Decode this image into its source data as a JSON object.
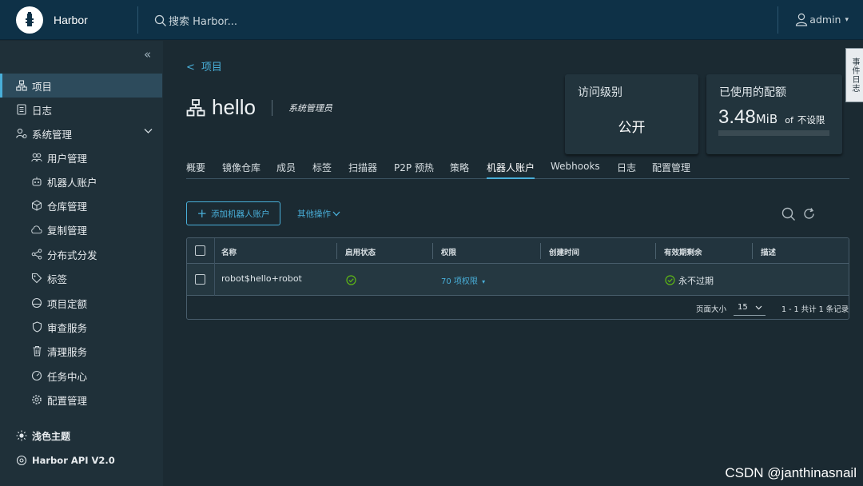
{
  "app": {
    "title": "Harbor"
  },
  "search": {
    "placeholder": "搜索 Harbor..."
  },
  "user": {
    "name": "admin"
  },
  "sidebar": {
    "items": [
      {
        "label": "项目",
        "icon": "projects-icon"
      },
      {
        "label": "日志",
        "icon": "logs-icon"
      },
      {
        "label": "系统管理",
        "icon": "admin-icon"
      },
      {
        "label": "用户管理",
        "icon": "users-icon"
      },
      {
        "label": "机器人账户",
        "icon": "robot-icon"
      },
      {
        "label": "仓库管理",
        "icon": "registry-icon"
      },
      {
        "label": "复制管理",
        "icon": "replication-icon"
      },
      {
        "label": "分布式分发",
        "icon": "distribution-icon"
      },
      {
        "label": "标签",
        "icon": "tag-icon"
      },
      {
        "label": "项目定额",
        "icon": "quota-icon"
      },
      {
        "label": "审查服务",
        "icon": "shield-icon"
      },
      {
        "label": "清理服务",
        "icon": "trash-icon"
      },
      {
        "label": "任务中心",
        "icon": "gauge-icon"
      },
      {
        "label": "配置管理",
        "icon": "gear-icon"
      }
    ],
    "theme_label": "浅色主题",
    "api_label": "Harbor API V2.0"
  },
  "breadcrumb": {
    "label": "项目"
  },
  "project": {
    "name": "hello",
    "role": "系统管理员"
  },
  "access_card": {
    "label": "访问级别",
    "value": "公开"
  },
  "quota_card": {
    "label": "已使用的配额",
    "value": "3.48",
    "unit": "MiB",
    "of": "of",
    "limit": "不设限"
  },
  "tabs": [
    "概要",
    "镜像仓库",
    "成员",
    "标签",
    "扫描器",
    "P2P 预热",
    "策略",
    "机器人账户",
    "Webhooks",
    "日志",
    "配置管理"
  ],
  "active_tab": "机器人账户",
  "actions": {
    "add_robot": "添加机器人账户",
    "other": "其他操作"
  },
  "table": {
    "headers": [
      "名称",
      "启用状态",
      "权限",
      "创建时间",
      "有效期剩余",
      "描述"
    ],
    "rows": [
      {
        "name": "robot$hello+robot",
        "enabled": true,
        "permissions": "70 项权限",
        "created": "",
        "expires": "永不过期",
        "description": ""
      }
    ],
    "page_size_label": "页面大小",
    "page_size": "15",
    "summary": "1 - 1 共计 1 条记录"
  },
  "event_tab": "事件日志",
  "watermark": "CSDN @janthinasnail",
  "colors": {
    "accent": "#49afd9",
    "header": "#0e3147",
    "sidebar": "#1f3039",
    "content": "#1b2a32",
    "success": "#5eb715"
  }
}
